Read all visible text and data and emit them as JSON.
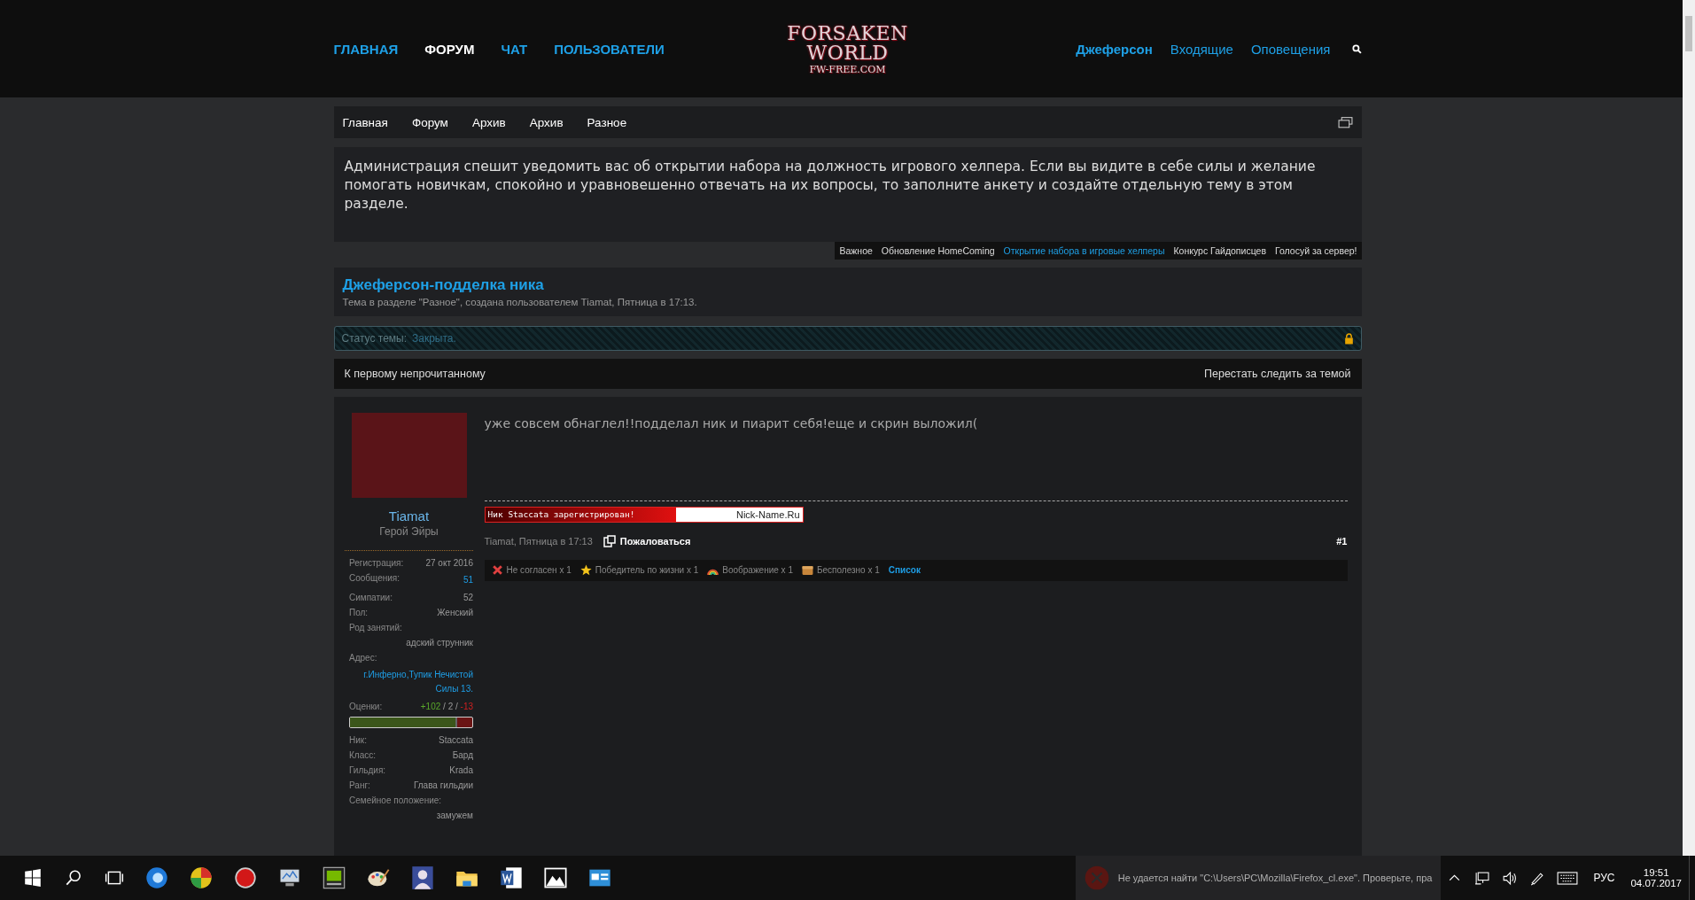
{
  "header": {
    "nav": [
      {
        "label": "ГЛАВНАЯ",
        "selected": false
      },
      {
        "label": "ФОРУМ",
        "selected": true
      },
      {
        "label": "ЧАТ",
        "selected": false
      },
      {
        "label": "ПОЛЬЗОВАТЕЛИ",
        "selected": false
      }
    ],
    "logo": {
      "line1": "FORSAKEN",
      "line2": "WORLD",
      "line3": "FW-FREE.COM"
    },
    "username": "Джеферсон",
    "links": [
      "Входящие",
      "Оповещения"
    ]
  },
  "breadcrumb": [
    "Главная",
    "Форум",
    "Архив",
    "Архив",
    "Разное"
  ],
  "notice": "Администрация спешит уведомить вас об открытии набора на должность игрового хелпера. Если вы видите в себе силы и желание помогать новичкам, спокойно и уравновешенно отвечать на их вопросы, то заполните анкету и создайте отдельную тему в этом разделе.",
  "notice_tabs": [
    {
      "label": "Важное",
      "selected": false
    },
    {
      "label": "Обновление HomeComing",
      "selected": false
    },
    {
      "label": "Открытие набора в игровые хелперы",
      "selected": true
    },
    {
      "label": "Конкурс Гайдописцев",
      "selected": false
    },
    {
      "label": "Голосуй за сервер!",
      "selected": false
    }
  ],
  "thread": {
    "title": "Джеферсон-подделка ника",
    "meta": "Тема в разделе \"Разное\", создана пользователем Tiamat, Пятница в 17:13."
  },
  "status": {
    "label": "Статус темы:",
    "value": "Закрыта."
  },
  "actions": {
    "left": "К первому непрочитанному",
    "right": "Перестать следить за темой"
  },
  "post": {
    "author": {
      "name": "Tiamat",
      "title": "Герой Эйры"
    },
    "stats": [
      {
        "label": "Регистрация:",
        "value": "27 окт 2016",
        "kind": "inline",
        "link": false
      },
      {
        "label": "Сообщения:",
        "value": "51",
        "kind": "inline",
        "link": true
      },
      {
        "label": "Симпатии:",
        "value": "52",
        "kind": "inline",
        "link": false
      },
      {
        "label": "Пол:",
        "value": "Женский",
        "kind": "inline",
        "link": false
      },
      {
        "label": "Род занятий:",
        "value": "адский струнник",
        "kind": "stacked",
        "link": false
      },
      {
        "label": "Адрес:",
        "value": "г.Инферно,Тупик Нечистой Силы 13.",
        "kind": "stacked",
        "link": true
      }
    ],
    "ratings": {
      "label": "Оценки:",
      "positive": "+102",
      "neutral": "/ 2 /",
      "negative": "-13",
      "level": 0.86
    },
    "game_stats": [
      {
        "label": "Ник:",
        "value": "Staccata",
        "kind": "inline",
        "link": false
      },
      {
        "label": "Класс:",
        "value": "Бард",
        "kind": "inline",
        "link": false
      },
      {
        "label": "Гильдия:",
        "value": "Krada",
        "kind": "inline",
        "link": false
      },
      {
        "label": "Ранг:",
        "value": "Глава гильдии",
        "kind": "inline",
        "link": false
      },
      {
        "label": "Семейное положение:",
        "value": "замужем",
        "kind": "stacked",
        "link": false
      }
    ],
    "message": "уже совсем обнаглел!!подделал ник и пиарит себя!еще и скрин выложил(",
    "signature": {
      "text": "Ник Staccata зарегистрирован!",
      "site": "Nick-Name.Ru"
    },
    "byline": "Tiamat, Пятница в 17:13",
    "report": "Пожаловаться",
    "number": "#1",
    "reactions": [
      {
        "kind": "cross",
        "label": "Не согласен x 1"
      },
      {
        "kind": "star",
        "label": "Победитель по жизни x 1"
      },
      {
        "kind": "rainbow",
        "label": "Воображение x 1"
      },
      {
        "kind": "box",
        "label": "Бесполезно x 1"
      }
    ],
    "reactions_link": "Список"
  },
  "notification": "Не удается найти \"C:\\Users\\PC\\Mozilla\\Firefox_cl.exe\". Проверьте, пра",
  "taskbar": {
    "apps": [
      {
        "kind": "browser"
      },
      {
        "kind": "ball"
      },
      {
        "kind": "record"
      },
      {
        "kind": "monitor"
      },
      {
        "kind": "gpu"
      },
      {
        "kind": "palette"
      },
      {
        "kind": "avatar"
      },
      {
        "kind": "folder"
      },
      {
        "kind": "word"
      },
      {
        "kind": "image"
      },
      {
        "kind": "window"
      }
    ],
    "lang": "РУС",
    "time": "19:51",
    "date": "04.07.2017"
  }
}
